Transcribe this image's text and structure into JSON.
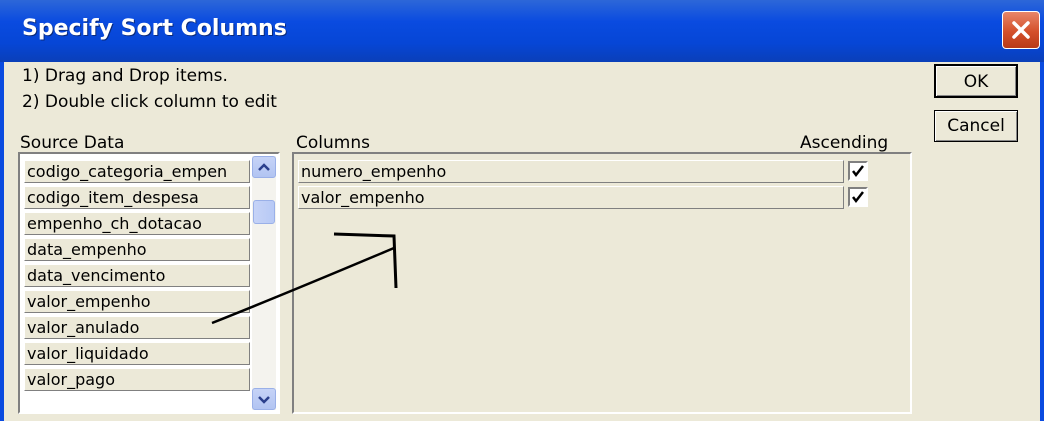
{
  "dialog": {
    "title": "Specify Sort Columns",
    "instructions": [
      "1) Drag and Drop items.",
      "2) Double click column to edit"
    ]
  },
  "buttons": {
    "ok": "OK",
    "cancel": "Cancel"
  },
  "source": {
    "label": "Source Data",
    "items": [
      "codigo_categoria_empen",
      "codigo_item_despesa",
      "empenho_ch_dotacao",
      "data_empenho",
      "data_vencimento",
      "valor_empenho",
      "valor_anulado",
      "valor_liquidado",
      "valor_pago"
    ]
  },
  "columns": {
    "label": "Columns",
    "ascending_label": "Ascending",
    "items": [
      {
        "name": "numero_empenho",
        "ascending": true
      },
      {
        "name": "valor_empenho",
        "ascending": true
      }
    ]
  },
  "icons": {
    "close": "close-icon",
    "scroll_up": "chevron-up-icon",
    "scroll_down": "chevron-down-icon",
    "check": "checkmark-icon"
  },
  "colors": {
    "titlebar": "#0a4be0",
    "dialog_bg": "#ece9d8",
    "close_button": "#d4502a"
  }
}
